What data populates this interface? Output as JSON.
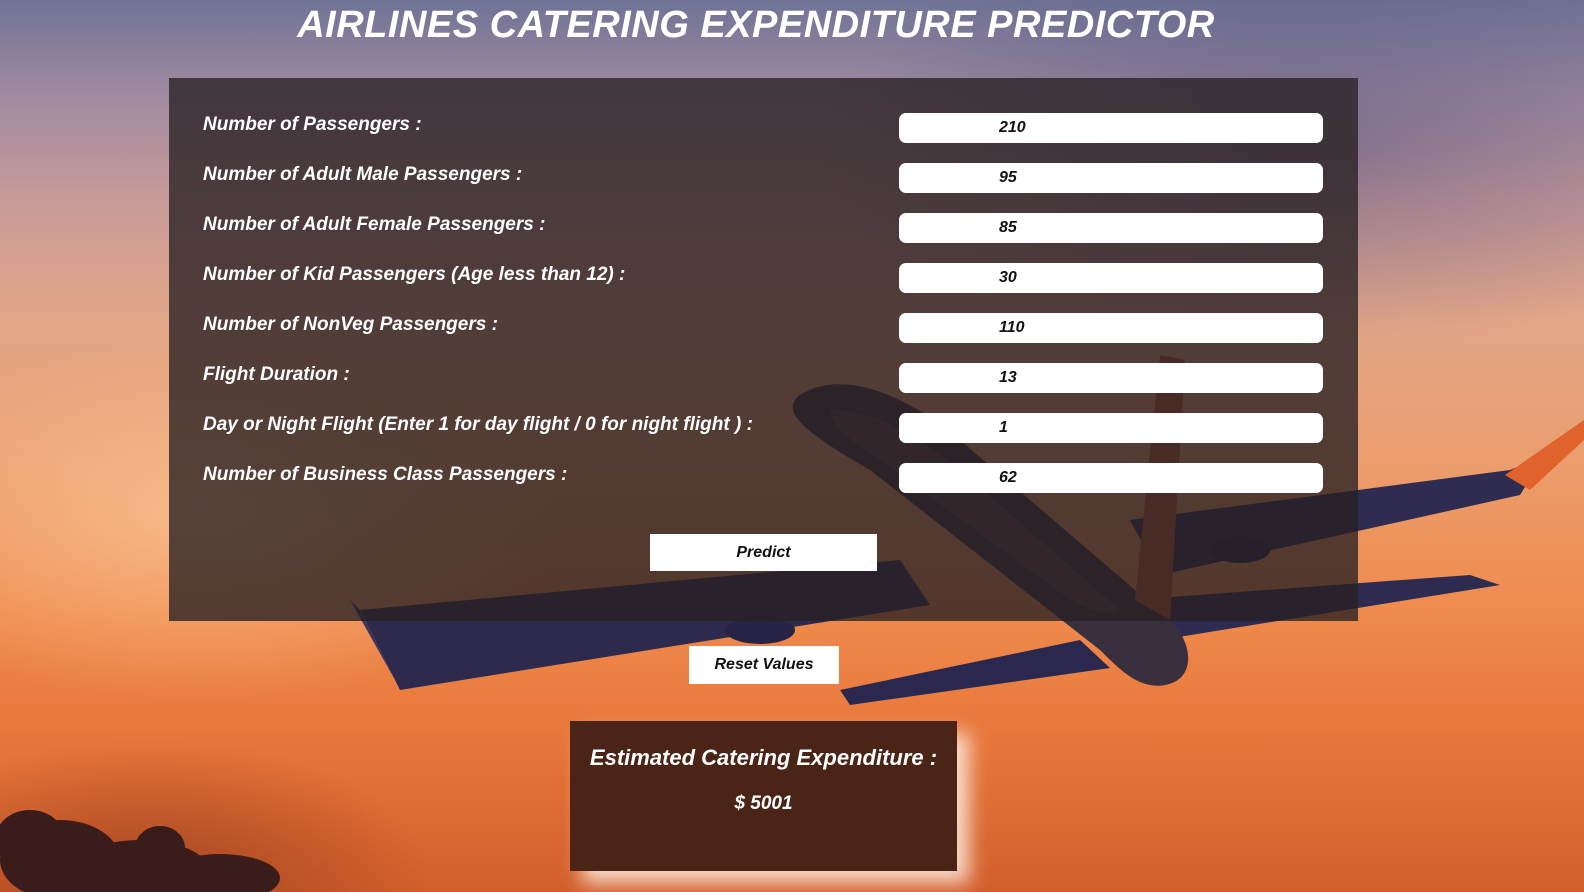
{
  "page": {
    "title": "AIRLINES CATERING EXPENDITURE PREDICTOR"
  },
  "form": {
    "fields": [
      {
        "label": "Number of Passengers :",
        "value": "210"
      },
      {
        "label": "Number of Adult Male Passengers :",
        "value": "95"
      },
      {
        "label": "Number of Adult Female Passengers :",
        "value": "85"
      },
      {
        "label": "Number of Kid Passengers (Age less than 12) :",
        "value": "30"
      },
      {
        "label": "Number of NonVeg Passengers :",
        "value": "110"
      },
      {
        "label": "Flight Duration :",
        "value": "13"
      },
      {
        "label": "Day or Night Flight (Enter 1 for day flight / 0 for night flight ) :",
        "value": "1"
      },
      {
        "label": "Number of Business Class Passengers :",
        "value": "62"
      }
    ],
    "predict_label": "Predict",
    "reset_label": "Reset Values"
  },
  "result": {
    "heading": "Estimated Catering Expenditure :",
    "value": "$ 5001"
  },
  "colors": {
    "panel_background": "#282023",
    "result_background": "#4a2416",
    "text": "#ffffff"
  }
}
